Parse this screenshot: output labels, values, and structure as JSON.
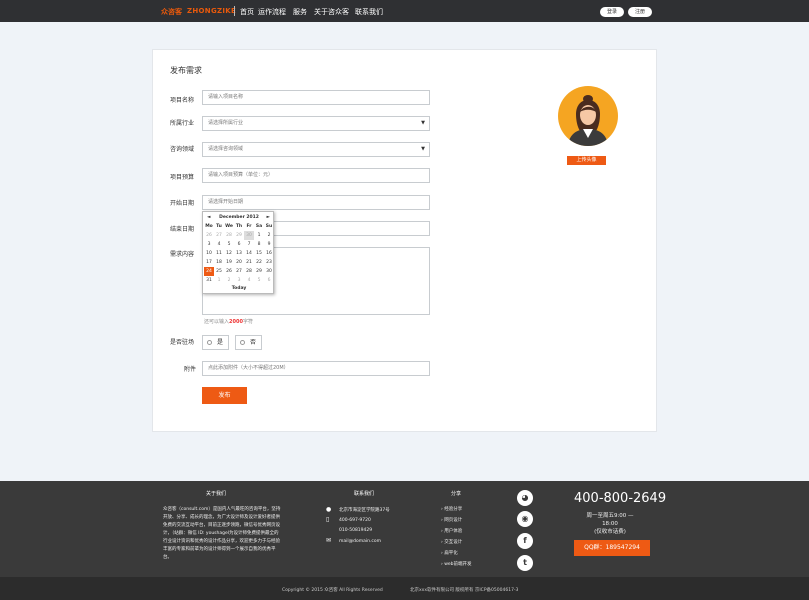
{
  "header": {
    "logo_cn": "众咨客",
    "logo_en": "ZHONGZIKE",
    "nav": [
      "首页",
      "运作流程",
      "服务",
      "关于咨众客",
      "联系我们"
    ],
    "login": "登录",
    "register": "注册"
  },
  "form": {
    "title": "发布需求",
    "project_name_label": "项目名称",
    "project_name_placeholder": "请输入项目名称",
    "industry_label": "所属行业",
    "industry_placeholder": "请选择所属行业",
    "field_label": "咨询领域",
    "field_placeholder": "请选择咨询领域",
    "budget_label": "项目预算",
    "budget_placeholder": "请输入项目预算（单位：元）",
    "start_label": "开始日期",
    "start_placeholder": "请选择开始日期",
    "end_label": "结束日期",
    "content_label": "需求内容",
    "hint_prefix": "还可以输入",
    "hint_count": "2000",
    "hint_suffix": "字符",
    "onsite_label": "是否驻场",
    "yes": "是",
    "no": "否",
    "attach_label": "附件",
    "attach_placeholder": "点此添加附件（大小不得超过20M）",
    "submit": "发布",
    "upload_avatar": "上传头像"
  },
  "calendar": {
    "title": "December 2012",
    "prev": "◄",
    "next": "►",
    "weekdays": [
      "Mo",
      "Tu",
      "We",
      "Th",
      "Fr",
      "Sa",
      "Su"
    ],
    "weeks": [
      [
        "26",
        "27",
        "28",
        "29",
        "30",
        "1",
        "2"
      ],
      [
        "3",
        "4",
        "5",
        "6",
        "7",
        "8",
        "9"
      ],
      [
        "10",
        "11",
        "12",
        "13",
        "14",
        "15",
        "16"
      ],
      [
        "17",
        "18",
        "19",
        "20",
        "21",
        "22",
        "23"
      ],
      [
        "24",
        "25",
        "26",
        "27",
        "28",
        "29",
        "30"
      ],
      [
        "31",
        "1",
        "2",
        "3",
        "4",
        "5",
        "6"
      ]
    ],
    "selected": "24",
    "today_label": "Today"
  },
  "footer": {
    "about_title": "关于我们",
    "about_text": "众咨客（consult.com）是国内人气最旺的咨询平台，坚持开放、分享、成长的理念，为广大设计师及设计爱好者提供免费的交流互动平台，目前正逐步领跑，微信号优秀网页设计，（站群：微信 ID: youshagel为设计师免费提供最全的行业设计资讯和优秀的设计作品分享，欢迎更多力于与经验丰富的专家和前辈为的设计师得到一个展示自我的优秀平台。",
    "contact_title": "联系我们",
    "address": "北京市海淀区学院路37号",
    "mobile": "400-697-9720",
    "tel": "010-50819429",
    "email": "mail@domain.com",
    "share_title": "分享",
    "links": [
      "经验分享",
      "网页设计",
      "用户体验",
      "交互设计",
      "扁平化",
      "web前端开发"
    ],
    "social": [
      "wechat-icon",
      "weibo-icon",
      "facebook-icon",
      "twitter-icon"
    ],
    "phone": "400-800-2649",
    "hours": "周一至周五9:00 — 18:00",
    "hours_note": "(仅收市话费)",
    "qq": "QQ群：189547294",
    "copyright": "Copyright © 2015 众咨客  All Rights Reserved",
    "company": "北京xxx软件有限公司  版权所有  京ICP备05004617-3"
  }
}
